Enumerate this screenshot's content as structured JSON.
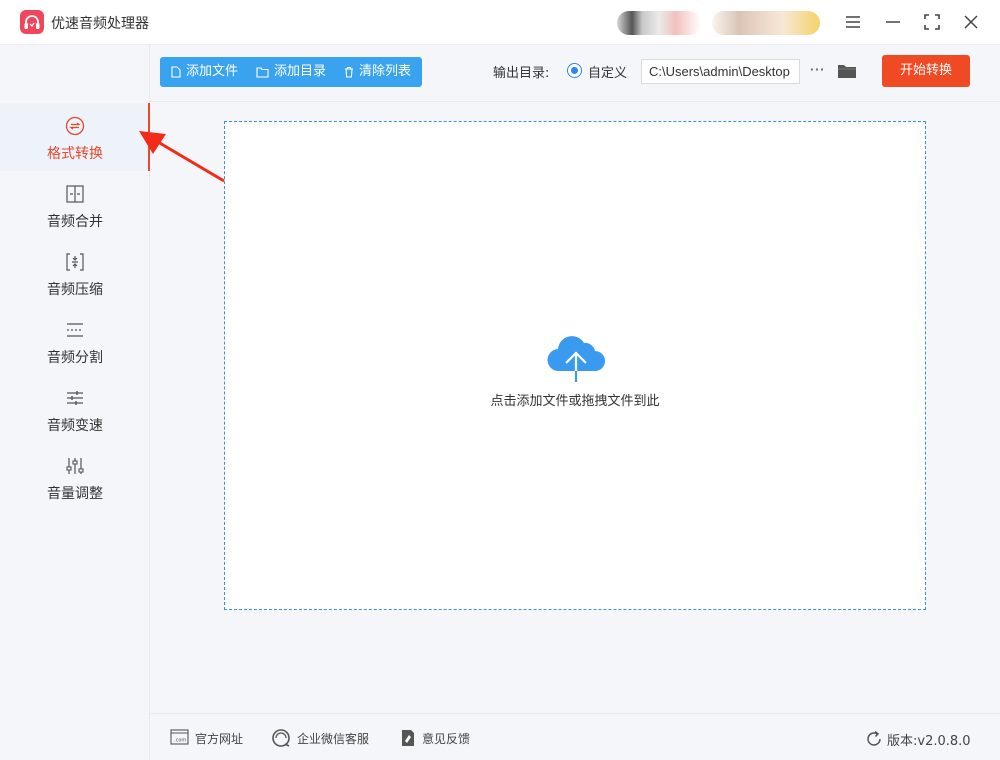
{
  "app": {
    "title": "优速音频处理器"
  },
  "sidebar": {
    "items": [
      {
        "label": "格式转换",
        "icon": "format-convert-icon",
        "active": true
      },
      {
        "label": "音频合并",
        "icon": "merge-icon",
        "active": false
      },
      {
        "label": "音频压缩",
        "icon": "compress-icon",
        "active": false
      },
      {
        "label": "音频分割",
        "icon": "split-icon",
        "active": false
      },
      {
        "label": "音频变速",
        "icon": "speed-icon",
        "active": false
      },
      {
        "label": "音量调整",
        "icon": "volume-icon",
        "active": false
      }
    ]
  },
  "toolbar": {
    "add_file": "添加文件",
    "add_dir": "添加目录",
    "clear_list": "清除列表",
    "output_label": "输出目录:",
    "custom_label": "自定义",
    "output_path": "C:\\Users\\admin\\Desktop",
    "more": "···",
    "start": "开始转换"
  },
  "dropzone": {
    "text": "点击添加文件或拖拽文件到此"
  },
  "footer": {
    "website": "官方网址",
    "wechat": "企业微信客服",
    "feedback": "意见反馈",
    "version": "版本:v2.0.8.0"
  },
  "colors": {
    "accent_red": "#f04a25",
    "toolbar_blue": "#3aa3f0",
    "upload_blue": "#3a9af0"
  }
}
